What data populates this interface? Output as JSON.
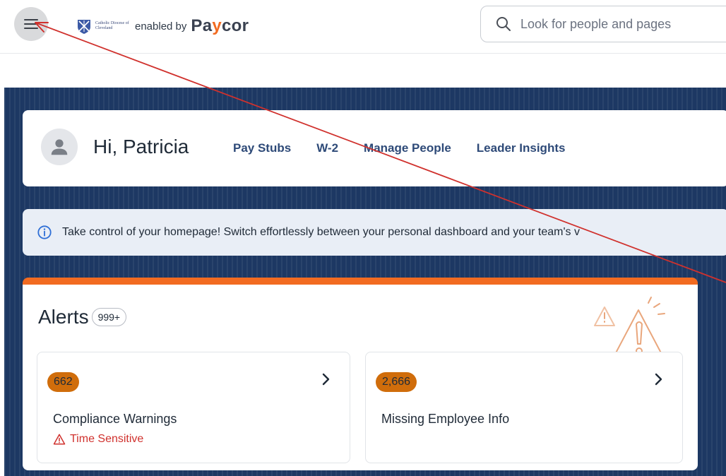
{
  "header": {
    "diocese_text": "Catholic Diocese of Cleveland",
    "enabled_by": "enabled by",
    "brand_pre": "Pa",
    "brand_accent": "y",
    "brand_post": "cor",
    "search_placeholder": "Look for people and pages"
  },
  "greeting": {
    "hello": "Hi, Patricia",
    "nav": [
      "Pay Stubs",
      "W-2",
      "Manage People",
      "Leader Insights"
    ]
  },
  "banner": {
    "message": "Take control of your homepage! Switch effortlessly between your personal dashboard and your team's v"
  },
  "alerts": {
    "title": "Alerts",
    "total_badge": "999+",
    "tiles": [
      {
        "count": "662",
        "label": "Compliance Warnings",
        "flag": "Time Sensitive"
      },
      {
        "count": "2,666",
        "label": "Missing Employee Info"
      }
    ]
  },
  "colors": {
    "accent_orange": "#f26b21",
    "badge_orange": "#d06d0b",
    "navy": "#1d3863",
    "nav_link": "#2e4a78",
    "danger": "#d0312d"
  },
  "icons": [
    "menu-icon",
    "diocese-seal-icon",
    "search-icon",
    "avatar-icon",
    "info-icon",
    "warning-illustration-icon",
    "chevron-right-icon",
    "warning-triangle-icon"
  ]
}
